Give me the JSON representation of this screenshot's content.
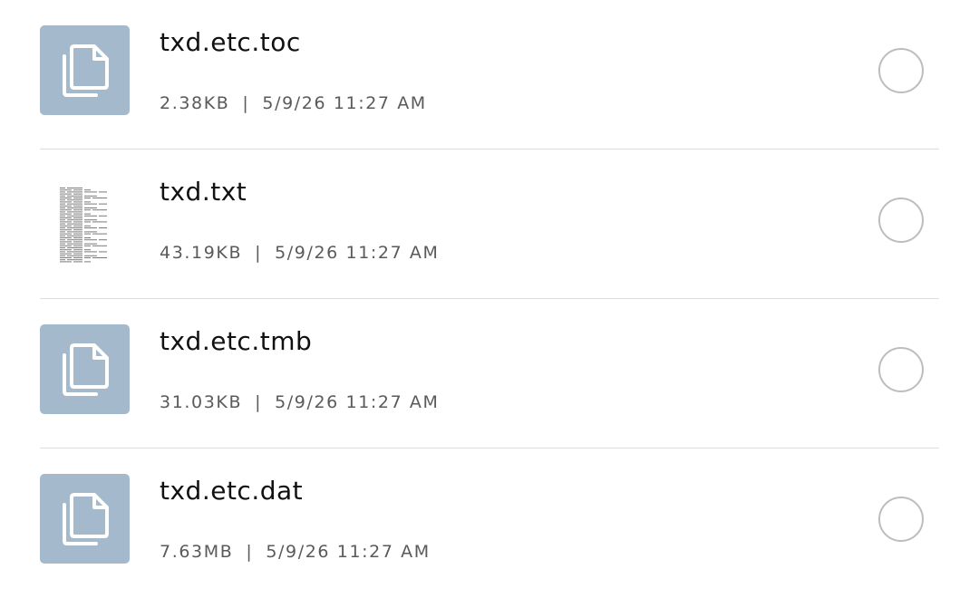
{
  "files": [
    {
      "name": "txd.etc.toc",
      "size": "2.38KB",
      "separator": "|",
      "date": "5/9/26 11:27 AM",
      "thumbnail": "document-copy-icon"
    },
    {
      "name": "txd.txt",
      "size": "43.19KB",
      "separator": "|",
      "date": "5/9/26 11:27 AM",
      "thumbnail": "text-preview"
    },
    {
      "name": "txd.etc.tmb",
      "size": "31.03KB",
      "separator": "|",
      "date": "5/9/26 11:27 AM",
      "thumbnail": "document-copy-icon"
    },
    {
      "name": "txd.etc.dat",
      "size": "7.63MB",
      "separator": "|",
      "date": "5/9/26 11:27 AM",
      "thumbnail": "document-copy-icon"
    }
  ],
  "colors": {
    "thumbnail_bg": "#a5b9cc",
    "divider": "#dedede",
    "select_border": "#bdbdbd"
  }
}
